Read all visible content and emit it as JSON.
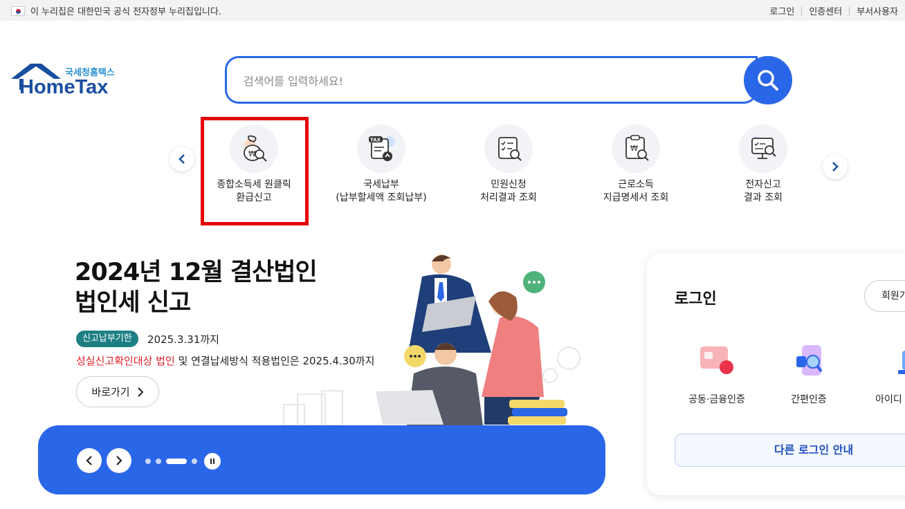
{
  "topbar": {
    "gov_notice": "이 누리집은 대한민국 공식 전자정부 누리집입니다.",
    "links": [
      "로그인",
      "인증센터",
      "부서사용자"
    ]
  },
  "logo": {
    "kr": "국세청홈택스",
    "en": "HomeTax"
  },
  "search": {
    "placeholder": "검색어를 입력하세요!"
  },
  "quick_menu": {
    "items": [
      {
        "line1": "종합소득세 원클릭",
        "line2": "환급신고",
        "icon": "money-bag-search-icon"
      },
      {
        "line1": "국세납부",
        "line2": "(납부할세액 조회납부)",
        "icon": "tax-document-upload-icon"
      },
      {
        "line1": "민원신청",
        "line2": "처리결과 조회",
        "icon": "checklist-search-icon"
      },
      {
        "line1": "근로소득",
        "line2": "지급명세서 조회",
        "icon": "clipboard-won-search-icon"
      },
      {
        "line1": "전자신고",
        "line2": "결과 조회",
        "icon": "monitor-search-icon"
      }
    ],
    "highlight_color": "#e60000"
  },
  "banner": {
    "title_line1": "2024년 12월 결산법인",
    "title_line2": "법인세 신고",
    "badge": "신고납부기한",
    "deadline": "2025.3.31까지",
    "sub_red": "성실신고확인대상 법인",
    "sub_rest": " 및 연결납세방식 적용법인은 2025.4.30까지",
    "goto_label": "바로가기",
    "accent_color": "#2a66e8"
  },
  "login": {
    "title": "로그인",
    "join_label": "회원가입",
    "options": [
      "공동·금융인증",
      "간편인증",
      "아이디 로그인"
    ],
    "other_login": "다른 로그인 안내"
  }
}
